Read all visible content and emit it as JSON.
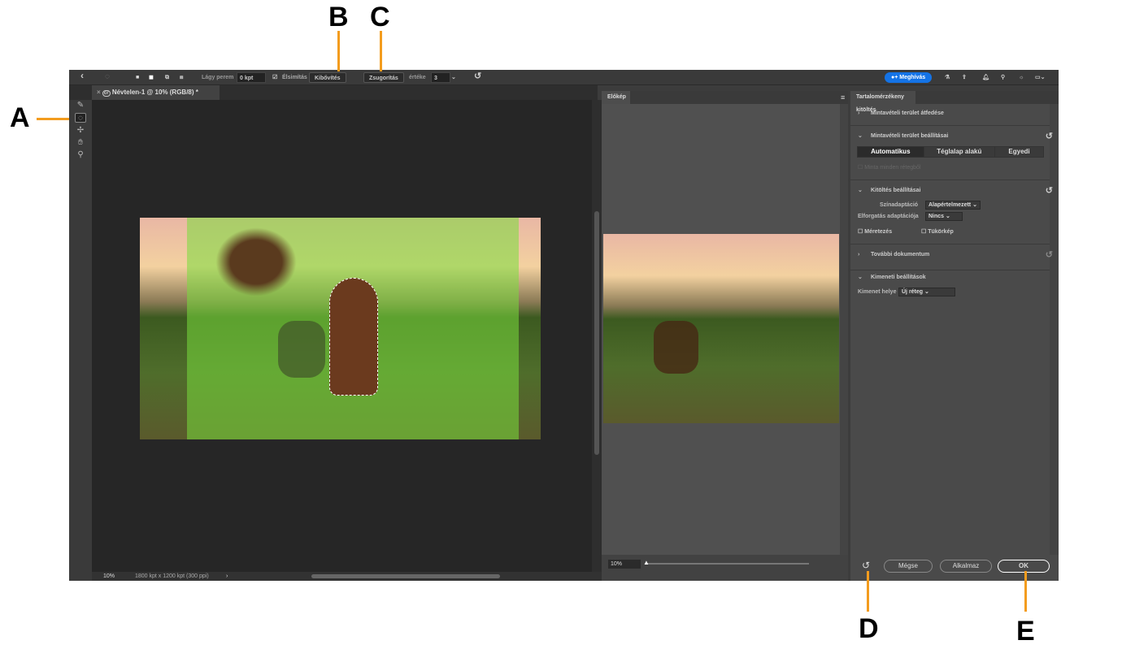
{
  "callouts": {
    "a": "A",
    "b": "B",
    "c": "C",
    "d": "D",
    "e": "E"
  },
  "toolbar": {
    "back_icon": "chevron-left",
    "feather_label": "Lágy perem",
    "feather_value": "0 kpt",
    "antialias_label": "Élsimítás",
    "expand_label": "Kibővítés",
    "contract_label": "Zsugorítás",
    "amount_label": "értéke",
    "amount_value": "3 kpt",
    "invite_label": "Meghívás"
  },
  "document": {
    "tab_title": "Névtelen-1 @ 10% (RGB/8) *",
    "zoom": "10%",
    "info": "1800 kpt x 1200 kpt (300 ppi)"
  },
  "preview": {
    "tab": "Előkép",
    "zoom": "10%",
    "zoom_fraction": 0.0
  },
  "panel": {
    "title": "Tartalomérzékeny kitöltés",
    "sampling_overlay": "Mintavételi terület átfedése",
    "sampling_settings": "Mintavételi terület beállításai",
    "sampling_modes": [
      "Automatikus",
      "Téglalap alakú",
      "Egyedi"
    ],
    "sample_all_layers": "Minta minden rétegből",
    "fill_settings": "Kitöltés beállításai",
    "color_adapt_label": "Színadaptáció",
    "color_adapt_value": "Alapértelmezett",
    "rotation_label": "Elforgatás adaptációja",
    "rotation_value": "Nincs",
    "scale_label": "Méretezés",
    "mirror_label": "Tükörkép",
    "more_doc": "További dokumentum",
    "output_settings": "Kimeneti beállítások",
    "output_label": "Kimenet helye",
    "output_value": "Új réteg"
  },
  "footer": {
    "cancel": "Mégse",
    "apply": "Alkalmaz",
    "ok": "OK"
  }
}
